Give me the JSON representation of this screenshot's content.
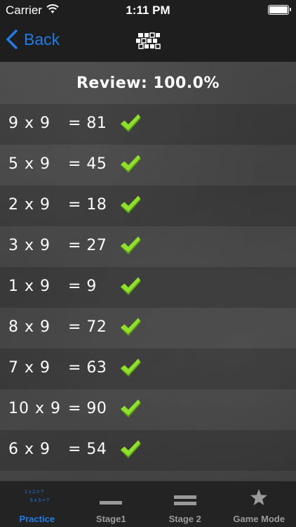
{
  "status_bar": {
    "carrier": "Carrier",
    "time": "1:11 PM",
    "icons": [
      "wifi-icon",
      "battery-icon"
    ]
  },
  "nav": {
    "back_label": "Back",
    "logo_icon": "pixel-grid-logo-icon"
  },
  "review": {
    "title": "Review:  100.0%"
  },
  "rows": [
    {
      "question": "9 x 9",
      "answer": "= 81",
      "correct": true
    },
    {
      "question": "5 x 9",
      "answer": "= 45",
      "correct": true
    },
    {
      "question": "2 x 9",
      "answer": "= 18",
      "correct": true
    },
    {
      "question": "3 x 9",
      "answer": "= 27",
      "correct": true
    },
    {
      "question": "1 x 9",
      "answer": "= 9",
      "correct": true
    },
    {
      "question": "8 x 9",
      "answer": "= 72",
      "correct": true
    },
    {
      "question": "7 x 9",
      "answer": "= 63",
      "correct": true
    },
    {
      "question": "10 x 9",
      "answer": "= 90",
      "correct": true
    },
    {
      "question": "6 x 9",
      "answer": "= 54",
      "correct": true
    }
  ],
  "tabs": [
    {
      "label": "Practice",
      "icon": "practice-icon",
      "active": true
    },
    {
      "label": "Stage1",
      "icon": "single-bar-icon",
      "active": false
    },
    {
      "label": "Stage 2",
      "icon": "double-bar-icon",
      "active": false
    },
    {
      "label": "Game Mode",
      "icon": "star-icon",
      "active": false
    }
  ],
  "practice_icon_text": {
    "line1": "1 x 2 = ?",
    "line2": "5 x 3 = ?"
  },
  "colors": {
    "accent": "#1f7ce8",
    "check_green": "#7ed321",
    "tab_inactive": "#9a9a9a",
    "background": "#444444"
  }
}
